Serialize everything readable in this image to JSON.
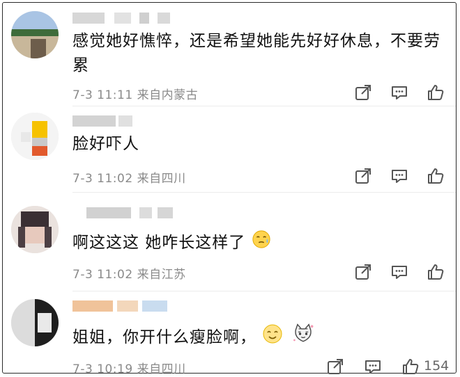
{
  "comments": [
    {
      "text": "感觉她好憔悴，还是希望她能先好好休息，不要劳累",
      "meta": "7-3 11:11 来自内蒙古"
    },
    {
      "text": "脸好吓人",
      "meta": "7-3 11:02 来自四川"
    },
    {
      "text": "啊这这这 她咋长这样了",
      "meta": "7-3 11:02 来自江苏"
    },
    {
      "text": "姐姐，你开什么瘦脸啊，",
      "meta": "7-3 10:19 来自四川",
      "likes": "154"
    }
  ],
  "icons": {
    "share": "share-icon",
    "comment": "comment-icon",
    "like": "thumbs-up-icon"
  }
}
